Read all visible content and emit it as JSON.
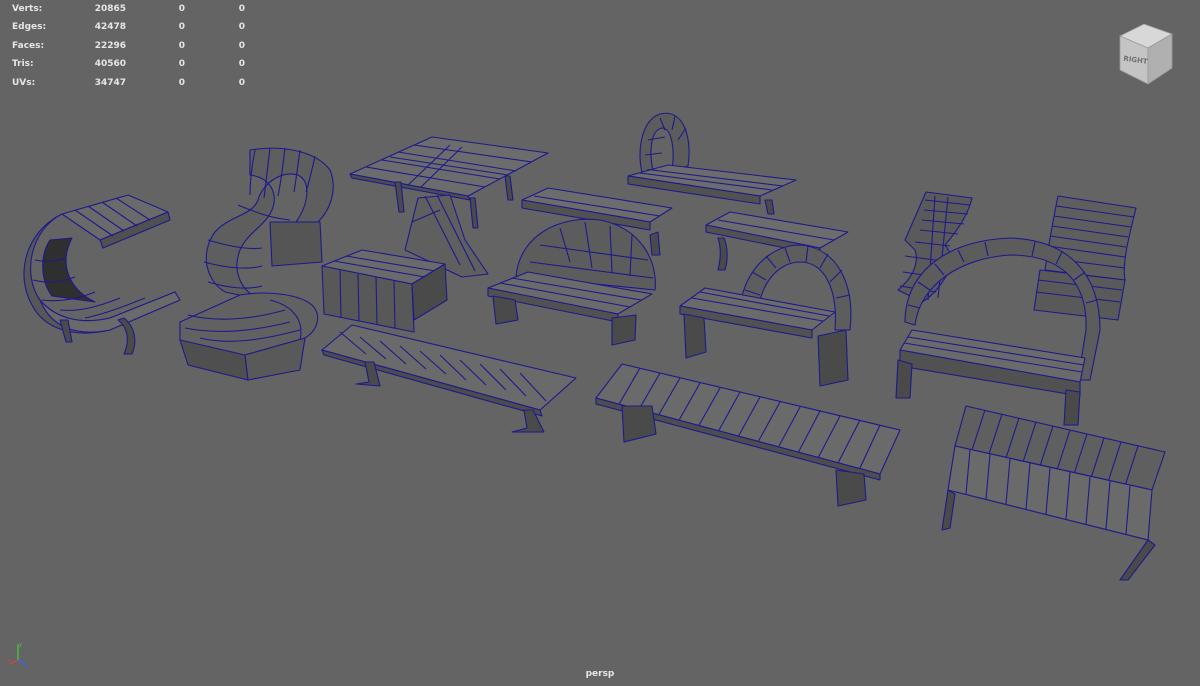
{
  "hud": {
    "rows": [
      {
        "label": "Verts:",
        "v1": "20865",
        "v2": "0",
        "v3": "0"
      },
      {
        "label": "Edges:",
        "v1": "42478",
        "v2": "0",
        "v3": "0"
      },
      {
        "label": "Faces:",
        "v1": "22296",
        "v2": "0",
        "v3": "0"
      },
      {
        "label": "Tris:",
        "v1": "40560",
        "v2": "0",
        "v3": "0"
      },
      {
        "label": "UVs:",
        "v1": "34747",
        "v2": "0",
        "v3": "0"
      }
    ]
  },
  "camera": {
    "label": "persp"
  },
  "view_cube": {
    "face_label": "RIGHT",
    "icon": "view-cube-icon"
  },
  "axis_gizmo": {
    "icon": "axis-gizmo-icon",
    "x_color": "#e04040",
    "y_color": "#40d040",
    "z_color": "#4060ff"
  },
  "colors": {
    "background": "#646464",
    "wire": "#1c1a8c",
    "shade_top": "#6a6a6a",
    "shade_side": "#545454",
    "shade_dark": "#3c3c3c"
  }
}
